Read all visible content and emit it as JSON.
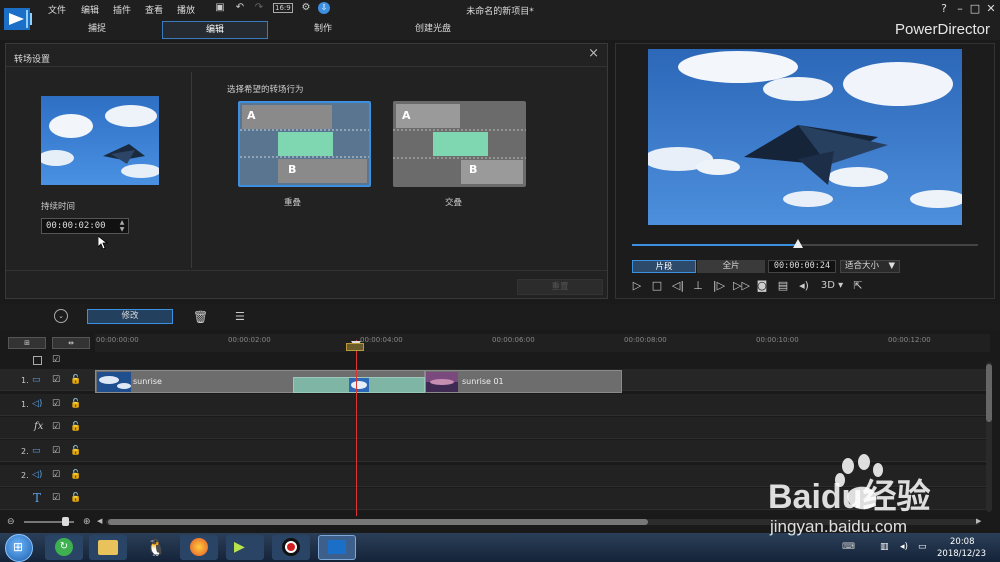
{
  "app": {
    "window_title": "未命名的新项目*",
    "brand": "PowerDirector",
    "menu": [
      "文件",
      "编辑",
      "插件",
      "查看",
      "播放"
    ],
    "toolbar_ratio": "16:9",
    "mode_tabs": [
      "捕捉",
      "编辑",
      "制作",
      "创建光盘"
    ],
    "window_buttons": [
      "?",
      "–",
      "□",
      "✕"
    ]
  },
  "transition_panel": {
    "title": "转场设置",
    "close": "×",
    "duration_label": "持续时间",
    "duration_value": "00:00:02:00",
    "behavior_label": "选择希望的转场行为",
    "options": [
      {
        "label": "重叠",
        "a": "A",
        "b": "B",
        "selected": true
      },
      {
        "label": "交叠",
        "a": "A",
        "b": "B",
        "selected": false
      }
    ],
    "reset_label": "重置"
  },
  "preview": {
    "clip_mode": "片段",
    "full_mode": "全片",
    "timecode": "00:00:00:24",
    "zoom": "适合大小",
    "stereo": "3D",
    "position_fraction": 0.48
  },
  "edit_toolbar": {
    "modify_label": "修改"
  },
  "timeline": {
    "ruler": [
      "00:00:00:00",
      "00:00:02:00",
      "00:00:04:00",
      "00:00:06:00",
      "00:00:08:00",
      "00:00:10:00",
      "00:00:12:00"
    ],
    "tracks": [
      {
        "num": "1.",
        "type": "video"
      },
      {
        "num": "1.",
        "type": "audio"
      },
      {
        "num": "",
        "type": "fx",
        "symbol": "fx"
      },
      {
        "num": "2.",
        "type": "video"
      },
      {
        "num": "2.",
        "type": "audio"
      },
      {
        "num": "",
        "type": "title",
        "symbol": "T"
      }
    ],
    "clips": [
      {
        "name": "sunrise"
      },
      {
        "name": "sunrise 01"
      }
    ]
  },
  "taskbar": {
    "time": "20:08",
    "date": "2018/12/23"
  },
  "watermark": {
    "text": "Baidu经验",
    "url": "jingyan.baidu.com"
  },
  "colors": {
    "accent": "#3d8fe0",
    "background": "#1a1a1a",
    "panel": "#222222",
    "playhead": "#dd3333"
  }
}
